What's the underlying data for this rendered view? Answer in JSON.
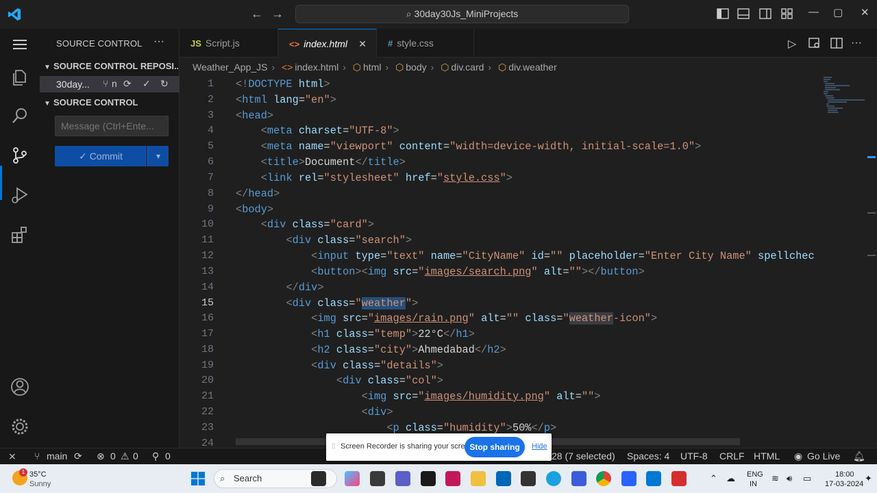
{
  "titlebar": {
    "search_text": "30day30Js_MiniProjects",
    "back_arrow": "←",
    "forward_arrow": "→",
    "minimize": "—",
    "restore": "▢",
    "close": "✕"
  },
  "sidebar": {
    "title": "SOURCE CONTROL",
    "more": "···",
    "repos_header": "SOURCE CONTROL REPOSI...",
    "repo_name": "30day...",
    "repo_branch_abbrev": "n",
    "scm_header": "SOURCE CONTROL",
    "message_placeholder": "Message (Ctrl+Ente...",
    "commit_label": "✓ Commit"
  },
  "tabs": [
    {
      "type": "JS",
      "label": "Script.js",
      "type_color": "#cbcb41"
    },
    {
      "type": "<>",
      "label": "index.html",
      "type_color": "#e37933",
      "close": "✕"
    },
    {
      "type": "#",
      "label": "style.css",
      "type_color": "#519aba"
    }
  ],
  "breadcrumb": {
    "folder": "Weather_App_JS",
    "file": "index.html",
    "crumb_html": "html",
    "crumb_body": "body",
    "crumb_card": "div.card",
    "crumb_weather": "div.weather"
  },
  "editor": {
    "current_line": 15,
    "lines": [
      1,
      2,
      3,
      4,
      5,
      6,
      7,
      8,
      9,
      10,
      11,
      12,
      13,
      14,
      15,
      16,
      17,
      18,
      19,
      20,
      21,
      22,
      23,
      24
    ]
  },
  "statusbar": {
    "branch": "main",
    "errors": "0",
    "warnings": "0",
    "ports": "0",
    "selection": "28 (7 selected)",
    "spaces": "Spaces: 4",
    "encoding": "UTF-8",
    "eol": "CRLF",
    "language": "HTML",
    "golive": "Go Live"
  },
  "share_banner": {
    "text": "Screen Recorder is sharing your screen.",
    "stop": "Stop sharing",
    "hide": "Hide"
  },
  "taskbar": {
    "temp": "35°C",
    "condition": "Sunny",
    "badge": "1",
    "search": "Search",
    "lang1": "ENG",
    "lang2": "IN",
    "time": "18:00",
    "date": "17-03-2024"
  },
  "colors": {
    "accent": "#0078d4",
    "commit_button": "#0e4da4",
    "share_button": "#1a73e8"
  }
}
